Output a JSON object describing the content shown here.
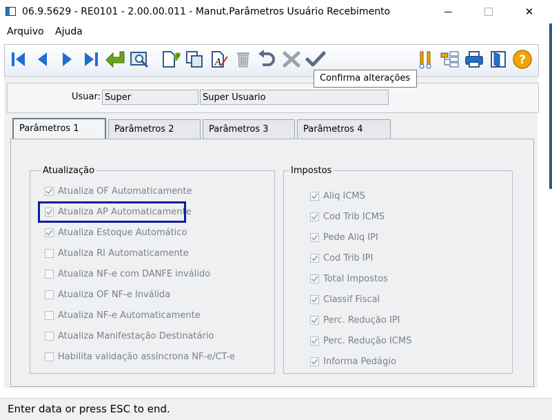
{
  "window": {
    "title": "06.9.5629 - RE0101 - 2.00.00.011 - Manut.Parâmetros Usuário Recebimento",
    "minimize_label": "—",
    "maximize_label": "☐",
    "close_label": "✕"
  },
  "menu": {
    "items": [
      "Arquivo",
      "Ajuda"
    ]
  },
  "toolbar": {
    "tooltip": "Confirma alterações",
    "icons": [
      "first-record-icon",
      "previous-record-icon",
      "next-record-icon",
      "last-record-icon",
      "goto-icon",
      "search-icon",
      "new-record-icon",
      "copy-record-icon",
      "edit-record-icon",
      "delete-record-icon",
      "undo-icon",
      "cancel-icon",
      "confirm-icon",
      "tools-icon",
      "tree-icon",
      "print-icon",
      "exit-icon",
      "help-icon"
    ]
  },
  "user": {
    "label": "Usuar:",
    "code": "Super",
    "name": "Super Usuario"
  },
  "tabs": [
    {
      "label": "Parâmetros 1",
      "active": true
    },
    {
      "label": "Parâmetros 2",
      "active": false
    },
    {
      "label": "Parâmetros 3",
      "active": false
    },
    {
      "label": "Parâmetros 4",
      "active": false
    }
  ],
  "atualizacao": {
    "title": "Atualização",
    "items": [
      {
        "label": "Atualiza OF Automaticamente",
        "checked": true
      },
      {
        "label": "Atualiza AP Automaticamente",
        "checked": true
      },
      {
        "label": "Atualiza Estoque Automático",
        "checked": true
      },
      {
        "label": "Atualiza RI Automaticamente",
        "checked": false
      },
      {
        "label": "Atualiza NF-e com DANFE inválido",
        "checked": false
      },
      {
        "label": "Atualiza OF NF-e Inválida",
        "checked": false
      },
      {
        "label": "Atualiza NF-e Automaticamente",
        "checked": false
      },
      {
        "label": "Atualiza Manifestação Destinatário",
        "checked": false
      },
      {
        "label": "Habilita validação assíncrona NF-e/CT-e",
        "checked": false
      }
    ]
  },
  "impostos": {
    "title": "Impostos",
    "items": [
      {
        "label": "Aliq ICMS",
        "checked": true
      },
      {
        "label": "Cod Trib ICMS",
        "checked": true
      },
      {
        "label": "Pede Aliq IPI",
        "checked": true
      },
      {
        "label": "Cod Trib IPI",
        "checked": true
      },
      {
        "label": "Total Impostos",
        "checked": true
      },
      {
        "label": "Classif Fiscal",
        "checked": true
      },
      {
        "label": "Perc. Redução IPI",
        "checked": true
      },
      {
        "label": "Perc. Redução ICMS",
        "checked": true
      },
      {
        "label": "Informa Pedágio",
        "checked": true
      }
    ]
  },
  "status": {
    "text": "Enter data or press ESC to end."
  },
  "colors": {
    "highlight": "#0a1d9c",
    "toolbar_blue": "#1f6fd1",
    "toolbar_green": "#6aa51e",
    "help_orange": "#f2a400"
  }
}
